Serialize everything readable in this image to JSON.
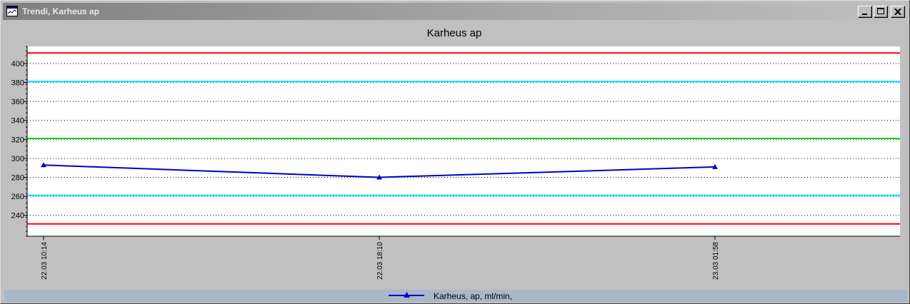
{
  "window": {
    "title": "Trendi, Karheus ap",
    "icon": "chart-window-icon",
    "controls": [
      "minimize-icon",
      "maximize-icon",
      "close-icon"
    ]
  },
  "chart_data": {
    "type": "line",
    "title": "Karheus ap",
    "xlabel": "",
    "ylabel": "",
    "ylim": [
      218,
      418
    ],
    "yticks": [
      240,
      260,
      280,
      300,
      320,
      340,
      360,
      380,
      400
    ],
    "x": [
      "22.03 10:14",
      "22.03 18:10",
      "23.03 01:58"
    ],
    "series": [
      {
        "name": "Karheus, ap, ml/min,",
        "values": [
          293,
          280,
          291
        ],
        "color": "#0000cc",
        "marker": "triangle"
      }
    ],
    "reference_lines": [
      {
        "value": 411,
        "color": "#ff0000"
      },
      {
        "value": 381,
        "color": "#00e5ff"
      },
      {
        "value": 321,
        "color": "#00dd00"
      },
      {
        "value": 261,
        "color": "#00e5ff"
      },
      {
        "value": 231,
        "color": "#ff0000"
      }
    ],
    "grid": true,
    "grid_style": "dotted horizontal",
    "legend": "bottom-center"
  },
  "legend": {
    "label": "Karheus, ap, ml/min,"
  }
}
